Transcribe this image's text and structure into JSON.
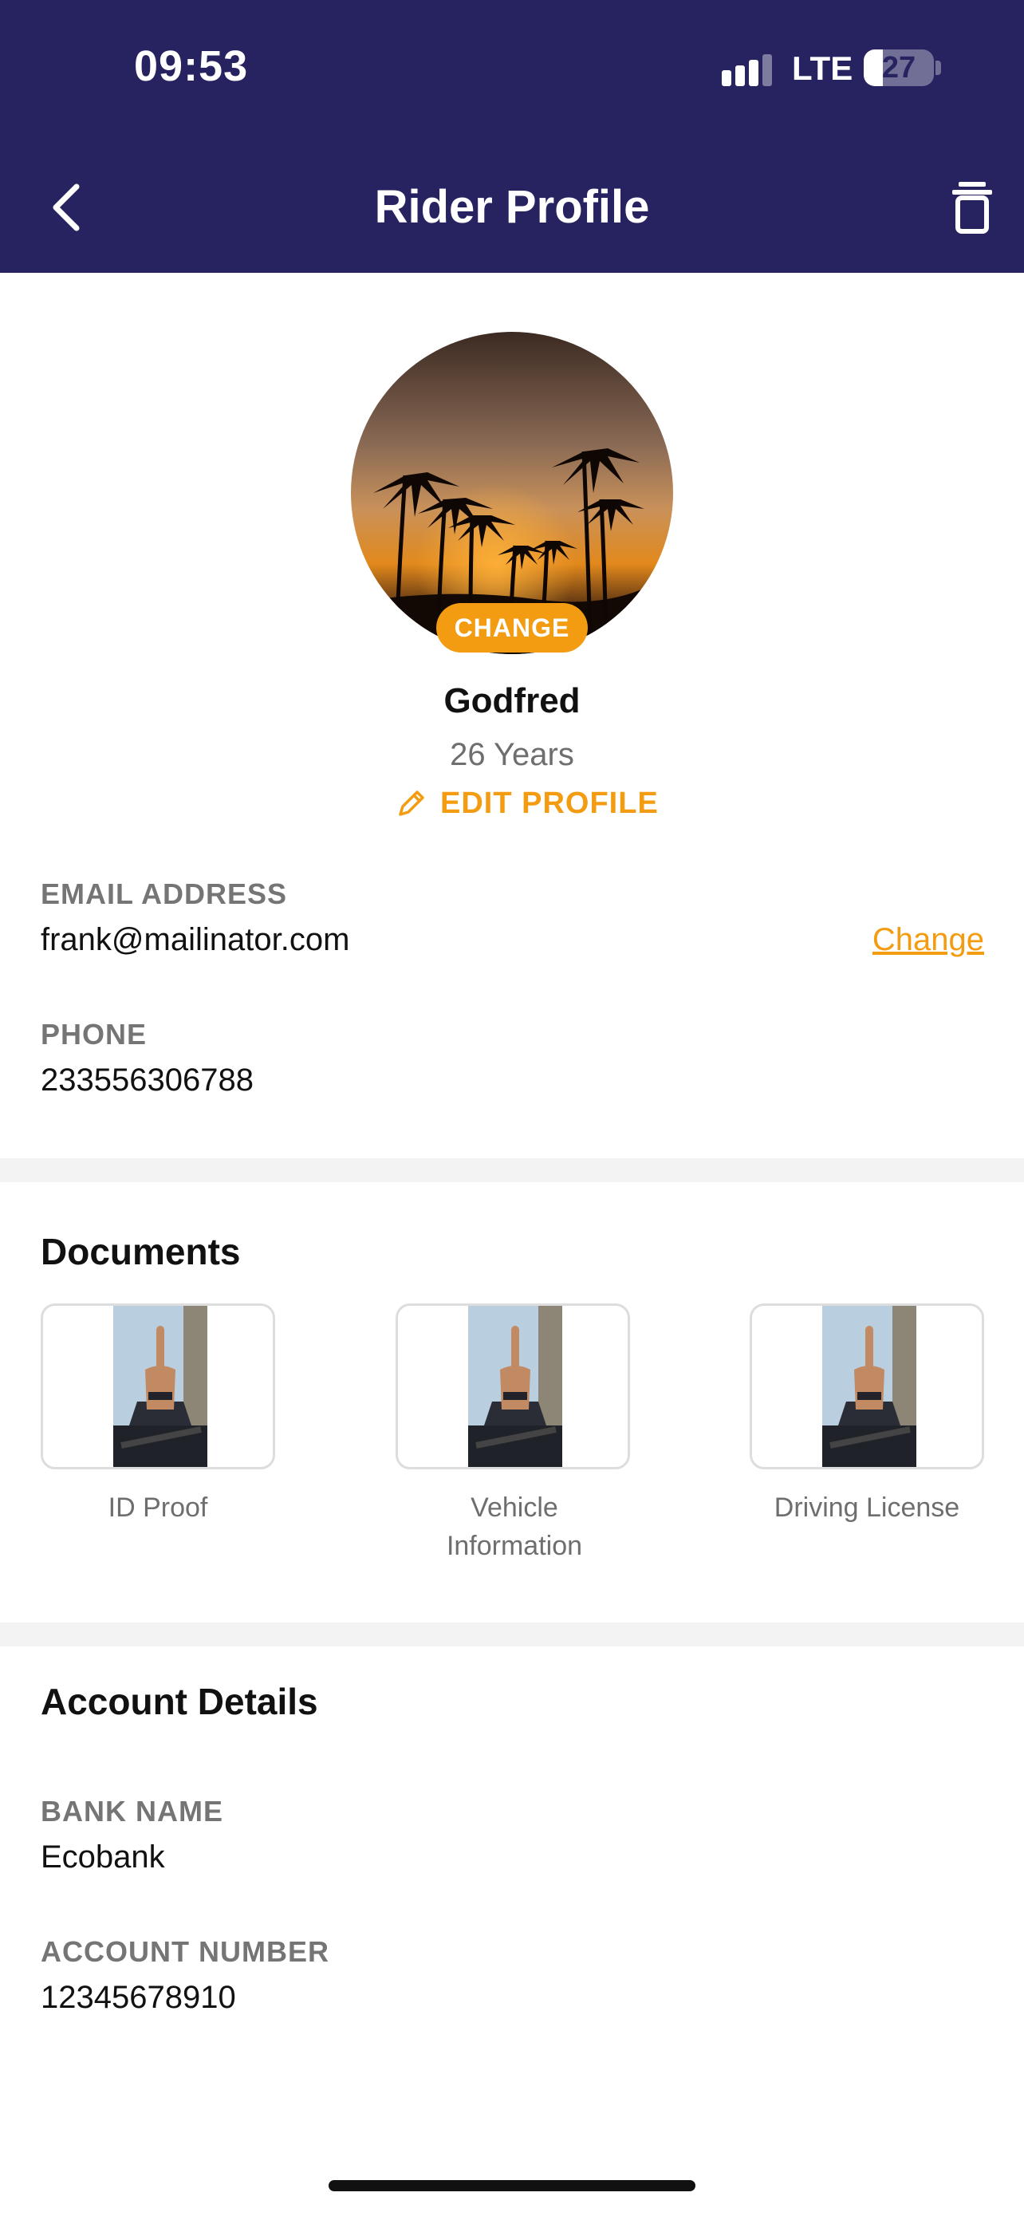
{
  "status_bar": {
    "time": "09:53",
    "network": "LTE",
    "battery": "27"
  },
  "header": {
    "title": "Rider Profile"
  },
  "profile": {
    "change_photo_label": "CHANGE",
    "name": "Godfred",
    "age": "26 Years",
    "edit_label": "EDIT PROFILE"
  },
  "contact": {
    "email_label": "EMAIL ADDRESS",
    "email_value": "frank@mailinator.com",
    "email_change_label": "Change",
    "phone_label": "PHONE",
    "phone_value": "233556306788"
  },
  "documents": {
    "title": "Documents",
    "items": [
      {
        "label": "ID Proof"
      },
      {
        "label": "Vehicle Information"
      },
      {
        "label": "Driving License"
      }
    ]
  },
  "account": {
    "title": "Account Details",
    "bank_label": "BANK NAME",
    "bank_value": "Ecobank",
    "account_label": "ACCOUNT NUMBER",
    "account_value": "12345678910"
  },
  "colors": {
    "header": "#272360",
    "accent": "#f39c12"
  }
}
